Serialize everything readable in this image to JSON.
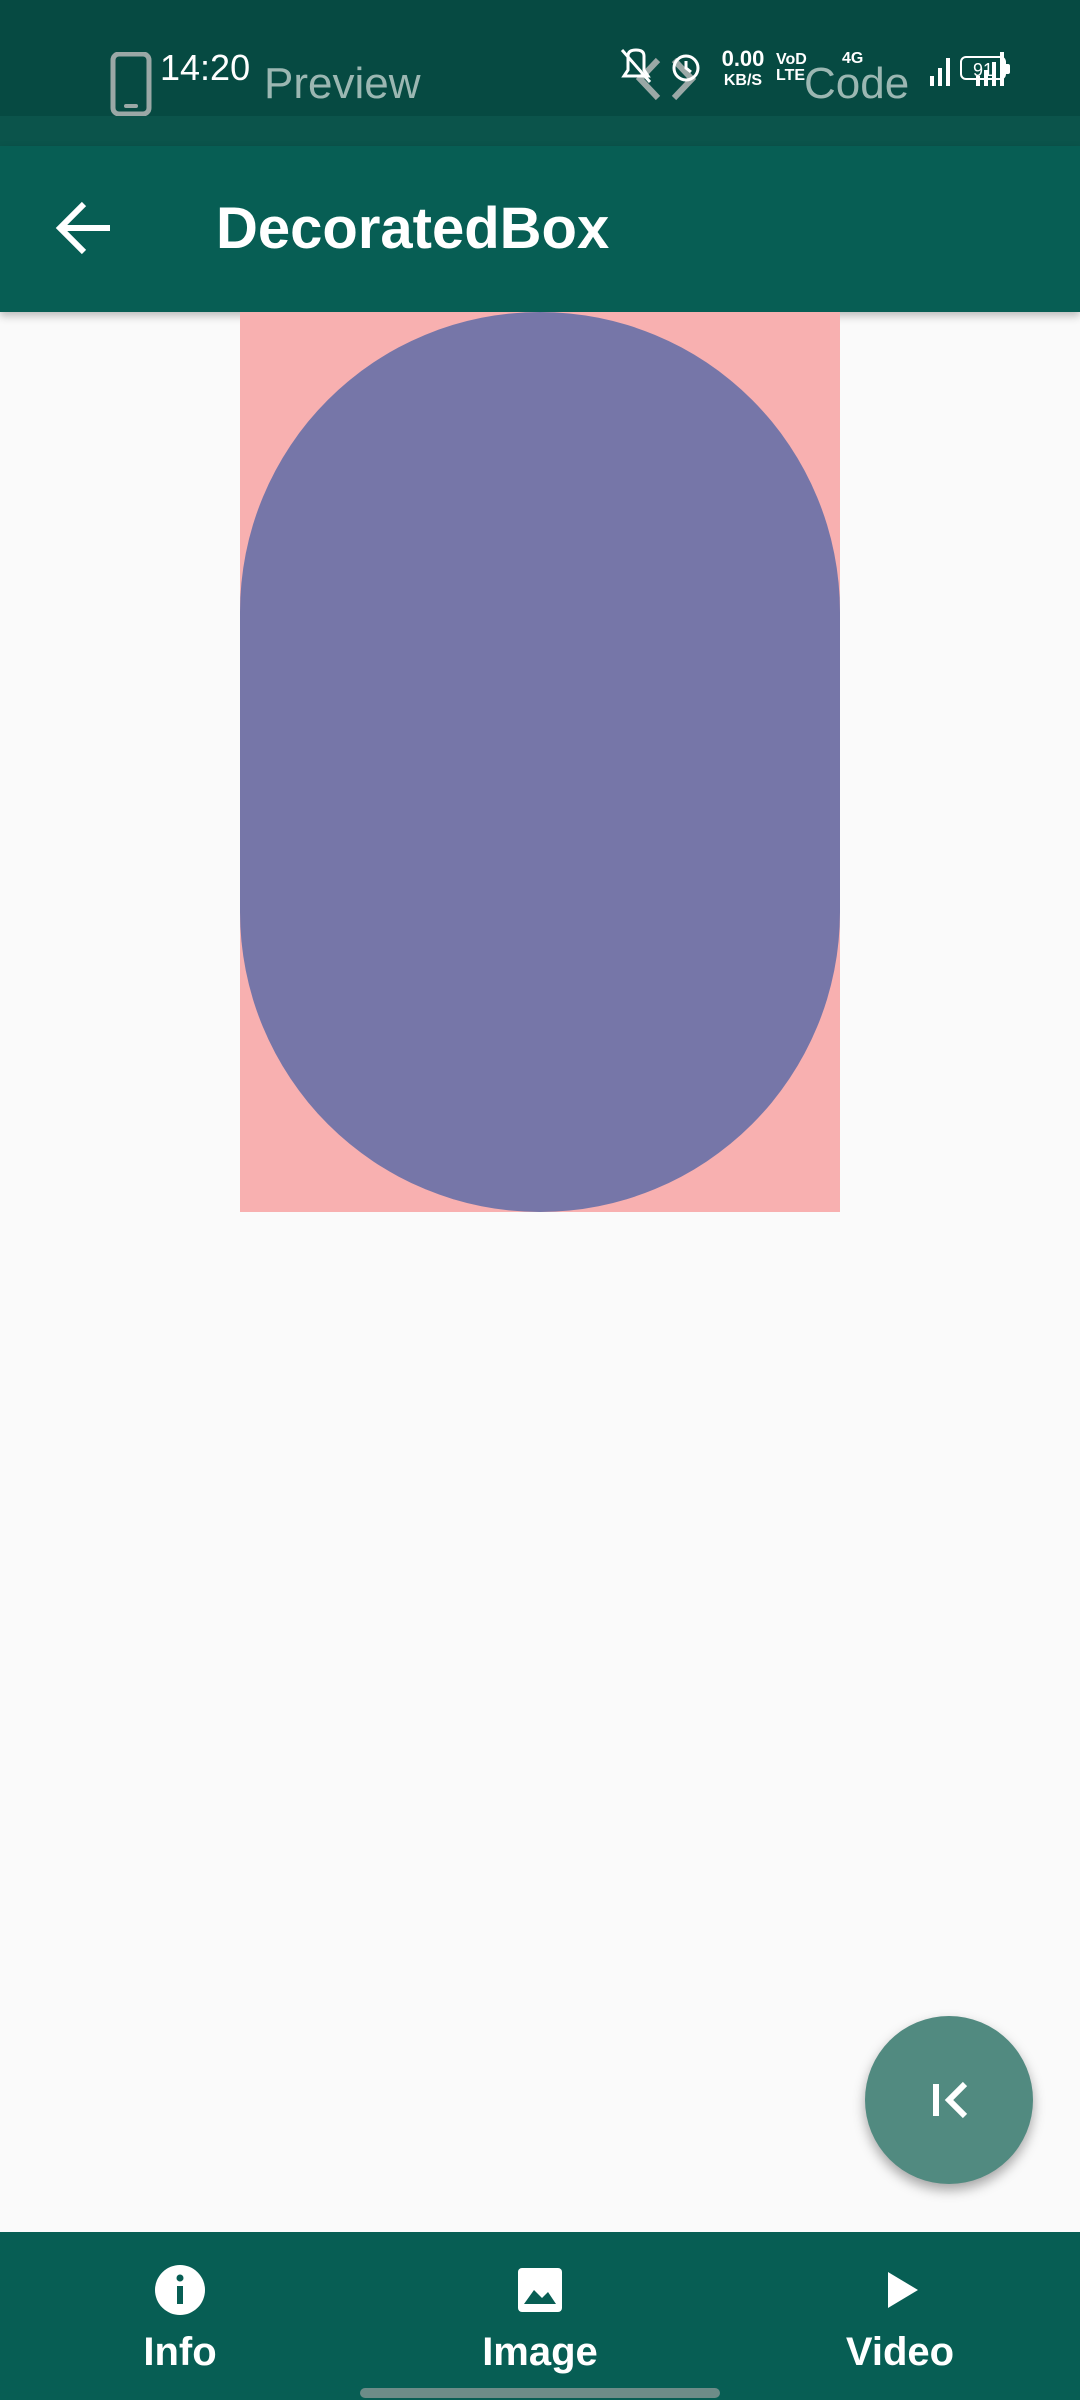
{
  "status_bar": {
    "time": "14:20",
    "net_speed_value": "0.00",
    "net_speed_unit": "KB/S",
    "volte": "VoD LTE",
    "network": "4G",
    "battery": "91"
  },
  "tabs": {
    "preview_label": "Preview",
    "code_label": "Code"
  },
  "app_bar": {
    "title": "DecoratedBox"
  },
  "preview": {
    "background_color": "#f8b0b0",
    "shape_color": "#7676a8",
    "shape": "stadium"
  },
  "fab": {
    "icon": "first-page-icon"
  },
  "bottom_nav": {
    "items": [
      {
        "label": "Info",
        "icon": "info-icon"
      },
      {
        "label": "Image",
        "icon": "image-icon"
      },
      {
        "label": "Video",
        "icon": "play-icon"
      }
    ]
  },
  "colors": {
    "primary": "#075e54",
    "primary_dark": "#064a42",
    "fab": "#518a80"
  }
}
